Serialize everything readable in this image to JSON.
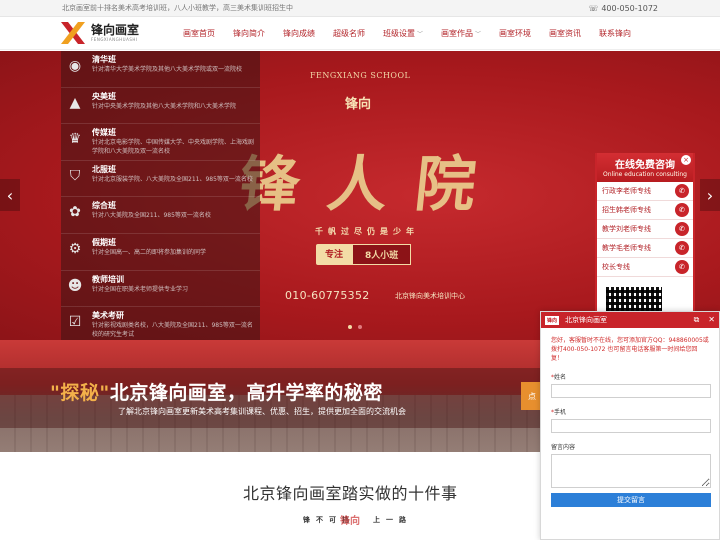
{
  "topbar": {
    "notice": "北京画室前十排名美术高考培训班，八人小班教学，高三美术集训班招生中",
    "phone": "400-050-1072"
  },
  "logo": {
    "name": "锋向画室",
    "pinyin": "FENGXIANGHUASHI"
  },
  "nav": {
    "items": [
      {
        "label": "画室首页"
      },
      {
        "label": "锋向简介"
      },
      {
        "label": "锋向成绩"
      },
      {
        "label": "超级名师"
      },
      {
        "label": "班级设置"
      },
      {
        "label": "画室作品"
      },
      {
        "label": "画室环境"
      },
      {
        "label": "画室资讯"
      },
      {
        "label": "联系锋向"
      }
    ]
  },
  "hero": {
    "school_en": "FENGXIANG SCHOOL",
    "school_cn": "锋向",
    "calligraphy": "锋人院",
    "motto": "千帆过尽仍是少年",
    "tag1": "专注",
    "tag2": "8人小班",
    "phone": "010-60775352",
    "center": "北京锋向美术培训中心",
    "slide_count": 2,
    "active_slide": 1
  },
  "sidebar": {
    "items": [
      {
        "title": "清华班",
        "desc": "针对清华大学美术学院及其他八大美术学院或双一流院校",
        "icon": "seal-icon"
      },
      {
        "title": "央美班",
        "desc": "针对中央美术学院及其他八大美术学院和八大美术学院",
        "icon": "pyramid-icon"
      },
      {
        "title": "传媒班",
        "desc": "针对北京电影学院、中国传媒大学、中央戏剧学院、上海戏剧学院和八大美院及双一流名校",
        "icon": "trophy-icon"
      },
      {
        "title": "北服班",
        "desc": "针对北京服装学院、八大美院及全国211、985等双一流名校",
        "icon": "shirt-icon"
      },
      {
        "title": "综合班",
        "desc": "针对八大美院及全国211、985等双一流名校",
        "icon": "palette-icon"
      },
      {
        "title": "假期班",
        "desc": "针对全国高一、高二的即将参加集训的同学",
        "icon": "gear-icon"
      },
      {
        "title": "教师培训",
        "desc": "针对全国在职美术老师提供专业学习",
        "icon": "people-icon"
      },
      {
        "title": "美术考研",
        "desc": "针对影视戏剧类名校，八大美院及全国211、985等双一流名校的研究生考试",
        "icon": "check-icon"
      }
    ]
  },
  "promo": {
    "quote_word": "\"探秘\"",
    "headline": "北京锋向画室，高升学率的秘密",
    "sub": "了解北京锋向画室更新美术高考集训课程、优惠、招生，提供更加全面的交流机会",
    "button": "点"
  },
  "section": {
    "title": "北京锋向画室踏实做的十件事",
    "subtitle": "锋不可挡",
    "subtitle2": "上一路",
    "deco": "锋向"
  },
  "consult": {
    "title": "在线免费咨询",
    "subtitle": "Online education consulting",
    "lines": [
      {
        "label": "行政李老师专线"
      },
      {
        "label": "招生韩老师专线"
      },
      {
        "label": "教学刘老师专线"
      },
      {
        "label": "教学毛老师专线"
      },
      {
        "label": "校长专线"
      }
    ]
  },
  "chat": {
    "header": "北京锋向画室",
    "logo_text": "锋向",
    "message": "您好，客服暂时不在线，您可添加官方QQ：948860005或拨打400-050-1072 也可留言电话客服第一时间给您回复！",
    "name_label": "姓名",
    "phone_label": "手机",
    "content_label": "留言内容",
    "submit": "提交留言"
  },
  "colors": {
    "brand": "#b3262b",
    "hero_bg": "#b01e22",
    "gold": "#e9c98b",
    "submit_blue": "#2c7fd8"
  }
}
